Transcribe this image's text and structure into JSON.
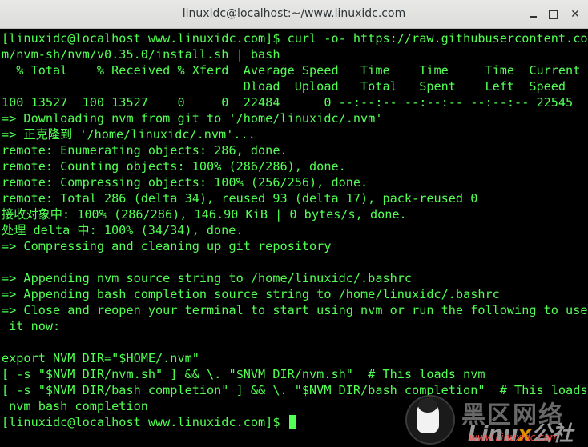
{
  "window": {
    "title": "linuxidc@localhost:~/www.linuxidc.com",
    "min_icon": "minimize-icon",
    "max_icon": "maximize-icon",
    "close_icon": "close-icon",
    "close_glyph": "✕"
  },
  "terminal": {
    "text_color": "#52ff52",
    "background": "#000000",
    "lines": [
      "[linuxidc@localhost www.linuxidc.com]$ curl -o- https://raw.githubusercontent.co",
      "m/nvm-sh/nvm/v0.35.0/install.sh | bash",
      "  % Total    % Received % Xferd  Average Speed   Time    Time     Time  Current",
      "                                 Dload  Upload   Total   Spent    Left  Speed",
      "100 13527  100 13527    0     0  22484      0 --:--:-- --:--:-- --:--:-- 22545",
      "=> Downloading nvm from git to '/home/linuxidc/.nvm'",
      "=> 正克隆到 '/home/linuxidc/.nvm'...",
      "remote: Enumerating objects: 286, done.",
      "remote: Counting objects: 100% (286/286), done.",
      "remote: Compressing objects: 100% (256/256), done.",
      "remote: Total 286 (delta 34), reused 93 (delta 17), pack-reused 0",
      "接收对象中: 100% (286/286), 146.90 KiB | 0 bytes/s, done.",
      "处理 delta 中: 100% (34/34), done.",
      "=> Compressing and cleaning up git repository",
      "",
      "=> Appending nvm source string to /home/linuxidc/.bashrc",
      "=> Appending bash_completion source string to /home/linuxidc/.bashrc",
      "=> Close and reopen your terminal to start using nvm or run the following to use",
      " it now:",
      "",
      "export NVM_DIR=\"$HOME/.nvm\"",
      "[ -s \"$NVM_DIR/nvm.sh\" ] && \\. \"$NVM_DIR/nvm.sh\"  # This loads nvm",
      "[ -s \"$NVM_DIR/bash_completion\" ] && \\. \"$NVM_DIR/bash_completion\"  # This loads",
      " nvm bash_completion"
    ],
    "prompt": "[linuxidc@localhost www.linuxidc.com]$ "
  },
  "watermark": {
    "chinese": "黑区网络",
    "logo_prefix": "Linu",
    "logo_x": "x",
    "logo_suffix": "公社",
    "url": "www.Linuxidc.com"
  }
}
